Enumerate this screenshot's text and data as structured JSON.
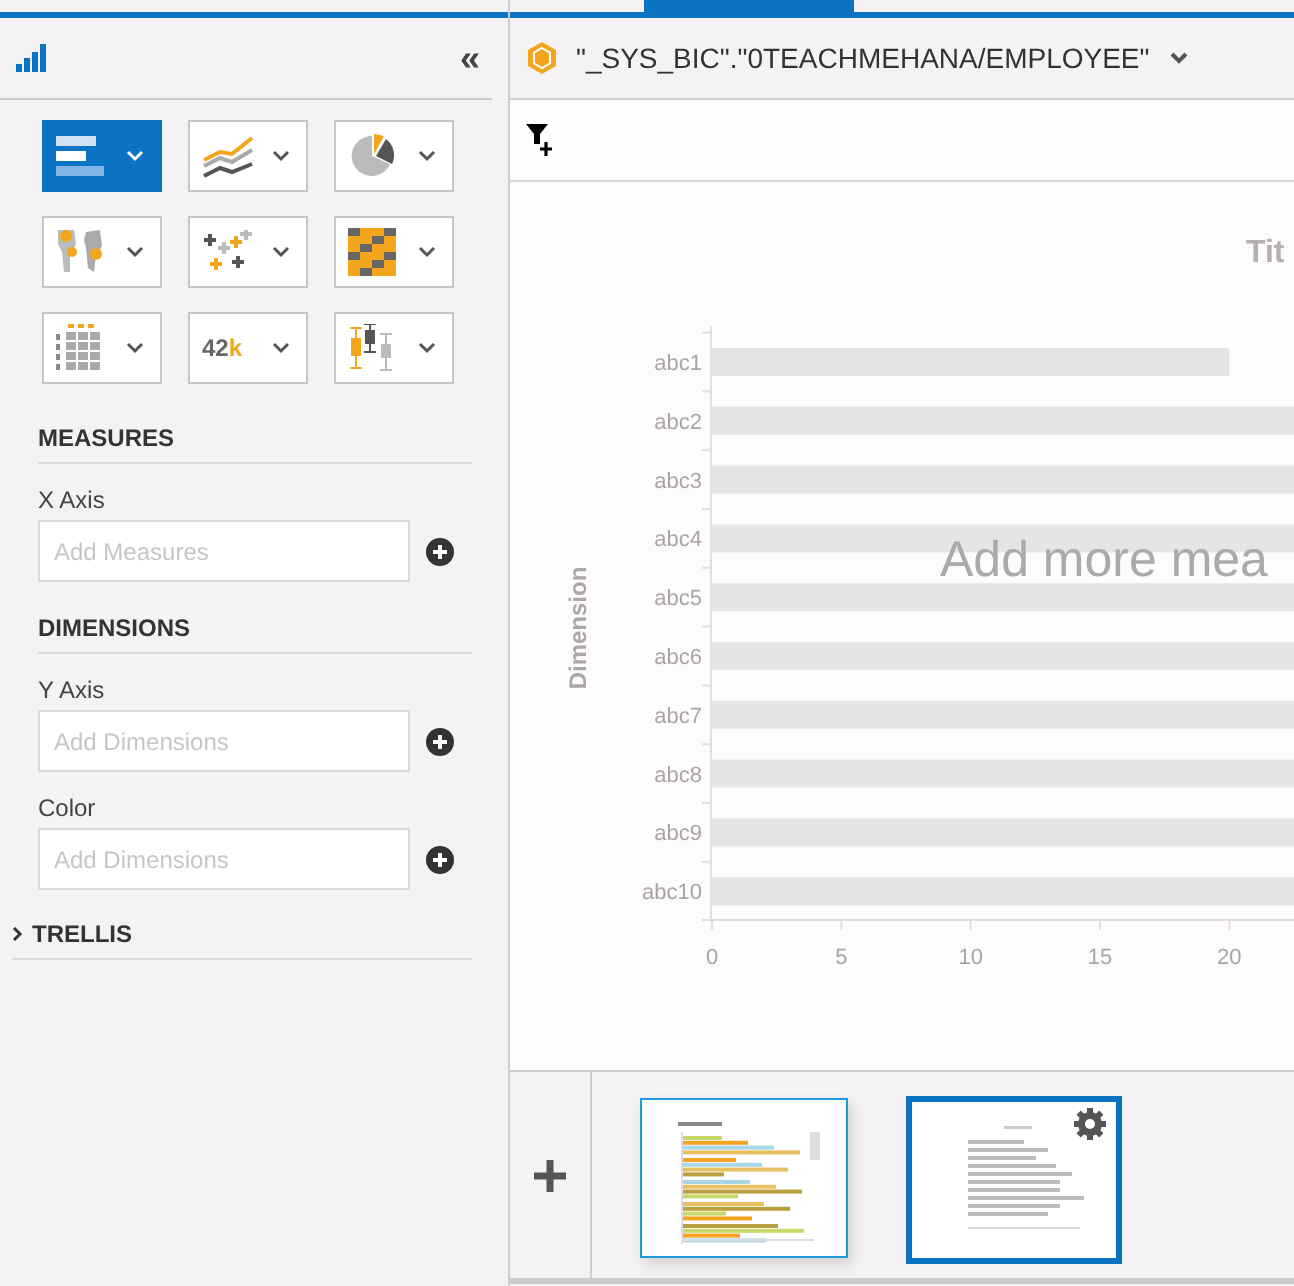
{
  "side_panel": {
    "collapse_symbol": "«",
    "chart_types": [
      {
        "kind": "bar",
        "selected": true
      },
      {
        "kind": "line",
        "selected": false
      },
      {
        "kind": "pie",
        "selected": false
      },
      {
        "kind": "geo",
        "selected": false
      },
      {
        "kind": "scatter",
        "selected": false
      },
      {
        "kind": "heatmap",
        "selected": false
      },
      {
        "kind": "table",
        "selected": false
      },
      {
        "kind": "number",
        "selected": false,
        "number": "42",
        "suffix": "k"
      },
      {
        "kind": "boxplot",
        "selected": false
      }
    ],
    "sections": [
      {
        "kind": "group",
        "title": "MEASURES",
        "fields": [
          {
            "label": "X Axis",
            "placeholder": "Add Measures"
          }
        ]
      },
      {
        "kind": "group",
        "title": "DIMENSIONS",
        "fields": [
          {
            "label": "Y Axis",
            "placeholder": "Add Dimensions"
          },
          {
            "label": "Color",
            "placeholder": "Add Dimensions"
          }
        ]
      },
      {
        "kind": "collapsible",
        "title": "TRELLIS",
        "expanded": false
      }
    ]
  },
  "header": {
    "source": "\"_SYS_BIC\".\"0TEACHMEHANA/EMPLOYEE\""
  },
  "chart": {
    "message": "Add more mea",
    "chart_data": {
      "type": "bar",
      "orientation": "horizontal",
      "title": "Tit",
      "ylabel": "Dimension",
      "categories": [
        "abc1",
        "abc2",
        "abc3",
        "abc4",
        "abc5",
        "abc6",
        "abc7",
        "abc8",
        "abc9",
        "abc10"
      ],
      "values": [
        20,
        22.5,
        22.5,
        22.5,
        22.5,
        22.5,
        22.5,
        22.5,
        22.5,
        22.5
      ],
      "xlim": [
        0,
        22.5
      ],
      "xticks": [
        0,
        5,
        10,
        15,
        20
      ]
    }
  },
  "thumbnails": [
    {
      "kind": "grouped",
      "selected": false
    },
    {
      "kind": "single",
      "selected": true
    }
  ]
}
